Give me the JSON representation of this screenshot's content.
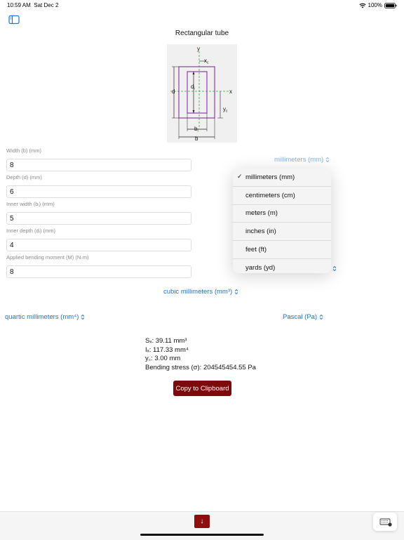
{
  "status_bar": {
    "time": "10:59 AM",
    "date": "Sat Dec 2",
    "battery": "100%"
  },
  "page": {
    "title": "Rectangular tube"
  },
  "diagram": {
    "labels": {
      "y": "y",
      "xc": "x",
      "xc_sub": "c",
      "d": "d",
      "di": "d",
      "di_sub": "i",
      "x": "x",
      "yc": "y",
      "yc_sub": "c",
      "bi": "b",
      "bi_sub": "i",
      "b": "b"
    },
    "colors": {
      "outer": "#8e3fa3",
      "dash": "#2aa84a",
      "line": "#222222",
      "bg": "#f0f0f0"
    }
  },
  "inputs": [
    {
      "label": "Width (b) (mm)",
      "value": "8"
    },
    {
      "label": "Depth (d) (mm)",
      "value": "6"
    },
    {
      "label": "Inner width (bᵢ) (mm)",
      "value": "5"
    },
    {
      "label": "Inner depth (dᵢ) (mm)",
      "value": "4"
    },
    {
      "label": "Applied bending moment (M) (N·m)",
      "value": "8"
    }
  ],
  "unit_selectors": {
    "length": "millimeters (mm)",
    "section_modulus": "cubic millimeters (mm³)",
    "moment_of_inertia": "quartic millimeters (mm⁴)",
    "stress": "Pascal (Pa)"
  },
  "length_menu": {
    "items": [
      {
        "label": "millimeters (mm)",
        "checked": true
      },
      {
        "label": "centimeters (cm)",
        "checked": false
      },
      {
        "label": "meters (m)",
        "checked": false
      },
      {
        "label": "inches (in)",
        "checked": false
      },
      {
        "label": "feet (ft)",
        "checked": false
      },
      {
        "label": "yards (yd)",
        "checked": false
      }
    ],
    "check_mark": "✓"
  },
  "results": {
    "sx": "Sₓ: 39.11 mm³",
    "ix": "Iₓ: 117.33 mm⁴",
    "yc": "y꜀: 3.00  mm",
    "stress": "Bending stress (σ): 204545454.55  Pa"
  },
  "copy_button": {
    "label": "Copy to Clipboard"
  },
  "toolbar": {
    "down_label": "↓"
  },
  "colors": {
    "accent": "#1a73d9",
    "button": "#7d0a0a"
  }
}
